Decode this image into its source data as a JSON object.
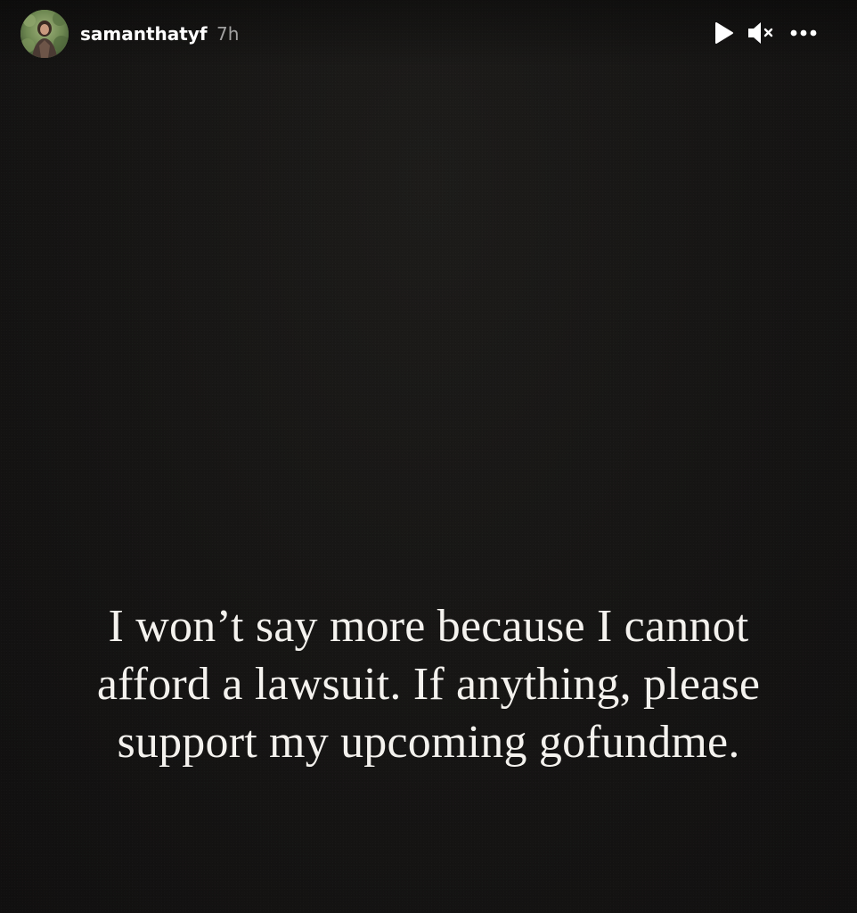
{
  "story": {
    "username": "samanthatyf",
    "timestamp": "7h",
    "caption_lines": [
      "I won’t say more because I cannot",
      "afford a lawsuit. If anything, please",
      "support my upcoming gofundme."
    ]
  },
  "controls": {
    "play_icon": "play-icon",
    "mute_icon": "muted-speaker-icon",
    "more_icon": "more-options-icon"
  },
  "colors": {
    "background": "#151413",
    "text": "#f4f2ee",
    "timestamp": "#a8a8a8"
  }
}
